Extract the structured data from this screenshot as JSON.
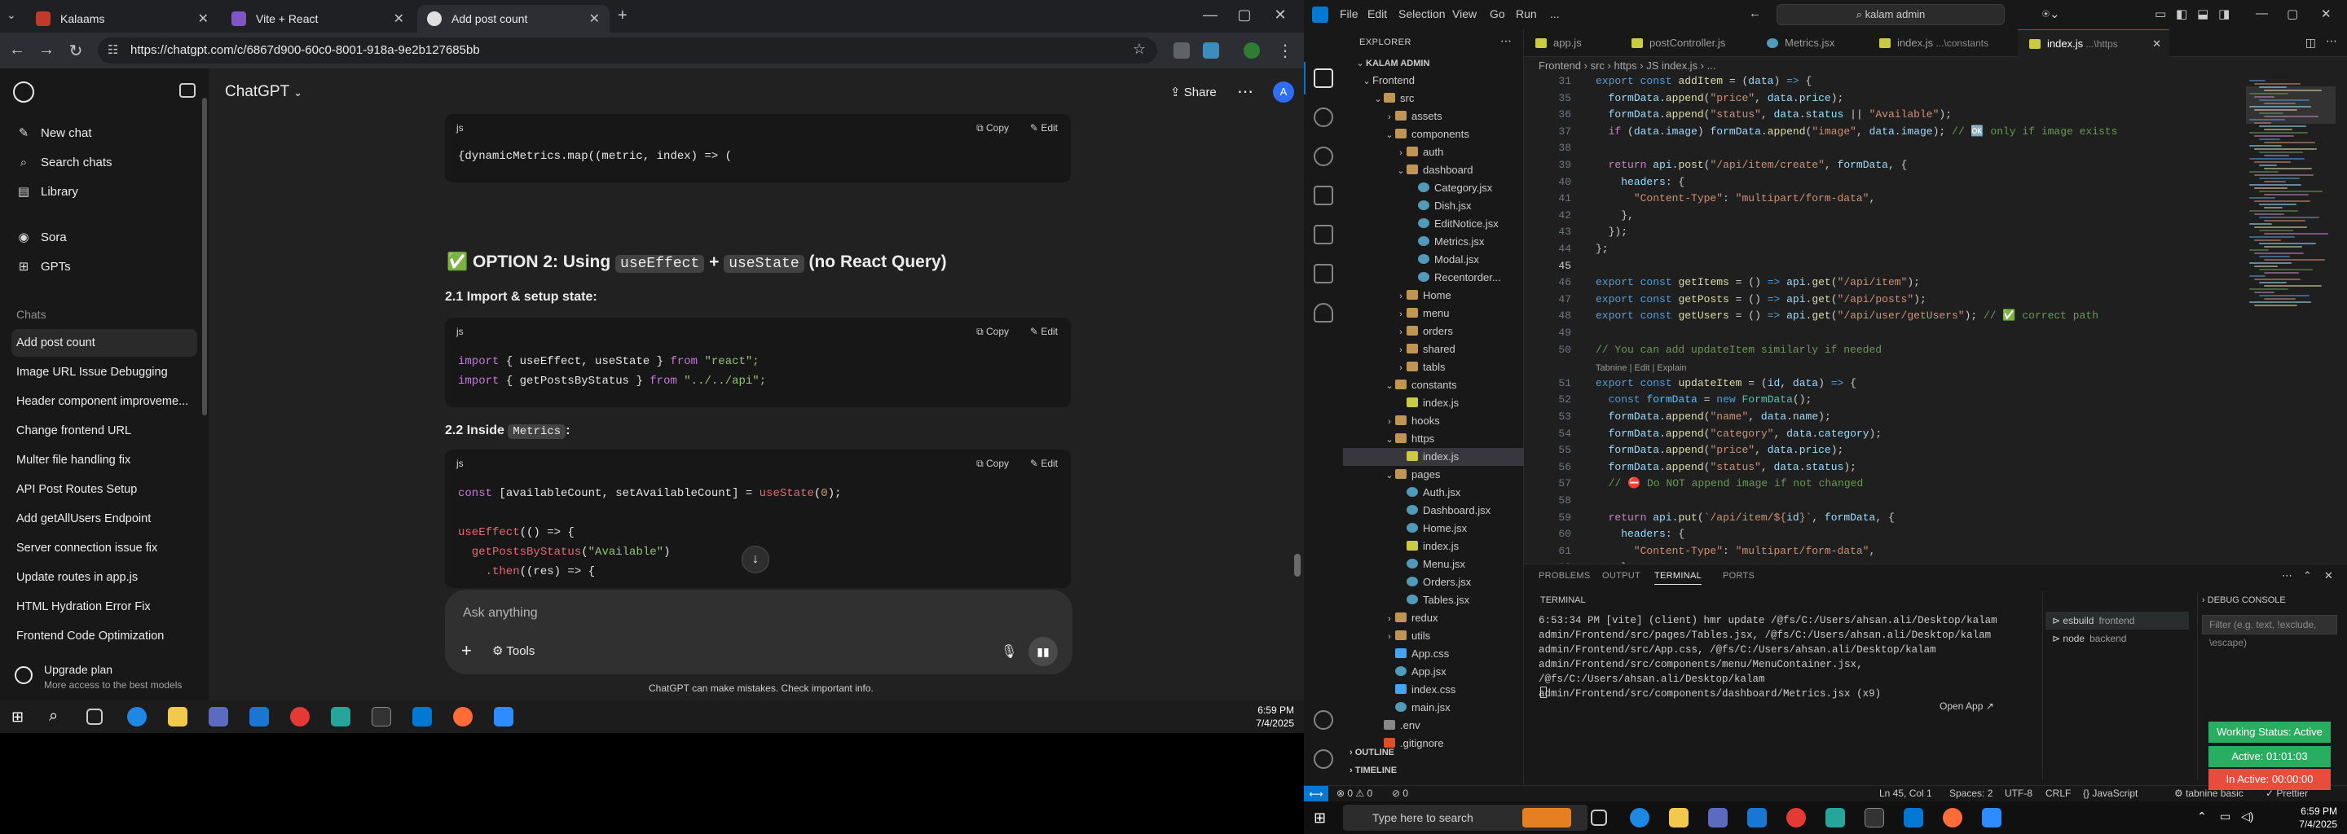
{
  "browser": {
    "tabs": [
      {
        "title": "Kalaams",
        "color": "#c0392b"
      },
      {
        "title": "Vite + React",
        "color": "#7e57c2"
      },
      {
        "title": "Add post count",
        "color": "#e0e0e0"
      }
    ],
    "new_tab": "+",
    "url": "https://chatgpt.com/c/6867d900-60c0-8001-918a-9e2b127685bb",
    "window_controls": {
      "minimize": "—",
      "maximize": "▢",
      "close": "✕"
    }
  },
  "chatgpt": {
    "sidebar": {
      "top_items": [
        {
          "label": "New chat",
          "icon": "edit-icon"
        },
        {
          "label": "Search chats",
          "icon": "search-icon"
        },
        {
          "label": "Library",
          "icon": "library-icon"
        },
        {
          "label": "Sora",
          "icon": "sora-icon"
        },
        {
          "label": "GPTs",
          "icon": "gpts-icon"
        }
      ],
      "chats_header": "Chats",
      "chats": [
        "Add post count",
        "Image URL Issue Debugging",
        "Header component improveme...",
        "Change frontend URL",
        "Multer file handling fix",
        "API Post Routes Setup",
        "Add getAllUsers Endpoint",
        "Server connection issue fix",
        "Update routes in app.js",
        "HTML Hydration Error Fix",
        "Frontend Code Optimization"
      ],
      "upgrade_title": "Upgrade plan",
      "upgrade_sub": "More access to the best models"
    },
    "header": {
      "model": "ChatGPT",
      "share": "Share",
      "avatar": "A"
    },
    "blocks": {
      "block1": {
        "lang": "js",
        "copy": "Copy",
        "edit": "Edit",
        "line": "{dynamicMetrics.map((metric, index) => ("
      },
      "option2_pre": "OPTION 2: Using",
      "option2_code1": "useEffect",
      "option2_plus": "+",
      "option2_code2": "useState",
      "option2_post": "(no React Query)",
      "h21": "2.1 Import & setup state:",
      "block2": {
        "lang": "js",
        "copy": "Copy",
        "edit": "Edit",
        "l1a": "import",
        "l1b": " { useEffect, useState } ",
        "l1c": "from",
        "l1d": "\"react\";",
        "l2a": "import",
        "l2b": " { getPostsByStatus } ",
        "l2c": "from",
        "l2d": "\"../../api\";"
      },
      "h22_pre": "2.2 Inside",
      "h22_code": "Metrics",
      "h22_post": ":",
      "block3": {
        "lang": "js",
        "copy": "Copy",
        "edit": "Edit",
        "l1a": "const",
        "l1b": " [availableCount, setAvailableCount] = ",
        "l1c": "useState",
        "l1d": "(",
        "l1e": "0",
        "l1f": ");",
        "l2a": "useEffect",
        "l2b": "(() => {",
        "l3a": "  getPostsByStatus",
        "l3b": "(",
        "l3c": "\"Available\"",
        "l3d": ")",
        "l4a": "    .then",
        "l4b": "((res) => {"
      }
    },
    "composer": {
      "placeholder": "Ask anything",
      "tools": "Tools"
    },
    "disclaimer": "ChatGPT can make mistakes. Check important info."
  },
  "taskbar_left": {
    "time": "6:59 PM",
    "date": "7/4/2025"
  },
  "vscode": {
    "menus": [
      "File",
      "Edit",
      "Selection",
      "View",
      "Go",
      "Run",
      "..."
    ],
    "search": "kalam admin",
    "explorer_header": "EXPLORER",
    "tree": [
      {
        "label": "KALAM ADMIN",
        "depth": 0,
        "chev": "⌄",
        "type": "root"
      },
      {
        "label": "Frontend",
        "depth": 1,
        "chev": "⌄",
        "type": "none"
      },
      {
        "label": "src",
        "depth": 2,
        "chev": "⌄",
        "type": "folder"
      },
      {
        "label": "assets",
        "depth": 3,
        "chev": "›",
        "type": "folder"
      },
      {
        "label": "components",
        "depth": 3,
        "chev": "⌄",
        "type": "folder"
      },
      {
        "label": "auth",
        "depth": 4,
        "chev": "›",
        "type": "folder"
      },
      {
        "label": "dashboard",
        "depth": 4,
        "chev": "⌄",
        "type": "folder"
      },
      {
        "label": "Category.jsx",
        "depth": 5,
        "chev": "",
        "type": "jsx"
      },
      {
        "label": "Dish.jsx",
        "depth": 5,
        "chev": "",
        "type": "jsx"
      },
      {
        "label": "EditNotice.jsx",
        "depth": 5,
        "chev": "",
        "type": "jsx"
      },
      {
        "label": "Metrics.jsx",
        "depth": 5,
        "chev": "",
        "type": "jsx"
      },
      {
        "label": "Modal.jsx",
        "depth": 5,
        "chev": "",
        "type": "jsx"
      },
      {
        "label": "Recentorder...",
        "depth": 5,
        "chev": "",
        "type": "jsx"
      },
      {
        "label": "Home",
        "depth": 4,
        "chev": "›",
        "type": "folder"
      },
      {
        "label": "menu",
        "depth": 4,
        "chev": "›",
        "type": "folder"
      },
      {
        "label": "orders",
        "depth": 4,
        "chev": "›",
        "type": "folder"
      },
      {
        "label": "shared",
        "depth": 4,
        "chev": "›",
        "type": "folder"
      },
      {
        "label": "tabls",
        "depth": 4,
        "chev": "›",
        "type": "folder"
      },
      {
        "label": "constants",
        "depth": 3,
        "chev": "⌄",
        "type": "folder"
      },
      {
        "label": "index.js",
        "depth": 4,
        "chev": "",
        "type": "js"
      },
      {
        "label": "hooks",
        "depth": 3,
        "chev": "›",
        "type": "folder"
      },
      {
        "label": "https",
        "depth": 3,
        "chev": "⌄",
        "type": "folder"
      },
      {
        "label": "index.js",
        "depth": 4,
        "chev": "",
        "type": "js",
        "selected": true
      },
      {
        "label": "pages",
        "depth": 3,
        "chev": "⌄",
        "type": "folder"
      },
      {
        "label": "Auth.jsx",
        "depth": 4,
        "chev": "",
        "type": "jsx"
      },
      {
        "label": "Dashboard.jsx",
        "depth": 4,
        "chev": "",
        "type": "jsx"
      },
      {
        "label": "Home.jsx",
        "depth": 4,
        "chev": "",
        "type": "jsx"
      },
      {
        "label": "index.js",
        "depth": 4,
        "chev": "",
        "type": "js"
      },
      {
        "label": "Menu.jsx",
        "depth": 4,
        "chev": "",
        "type": "jsx"
      },
      {
        "label": "Orders.jsx",
        "depth": 4,
        "chev": "",
        "type": "jsx"
      },
      {
        "label": "Tables.jsx",
        "depth": 4,
        "chev": "",
        "type": "jsx"
      },
      {
        "label": "redux",
        "depth": 3,
        "chev": "›",
        "type": "folder"
      },
      {
        "label": "utils",
        "depth": 3,
        "chev": "›",
        "type": "folder"
      },
      {
        "label": "App.css",
        "depth": 3,
        "chev": "",
        "type": "css"
      },
      {
        "label": "App.jsx",
        "depth": 3,
        "chev": "",
        "type": "jsx"
      },
      {
        "label": "index.css",
        "depth": 3,
        "chev": "",
        "type": "css"
      },
      {
        "label": "main.jsx",
        "depth": 3,
        "chev": "",
        "type": "jsx"
      },
      {
        "label": ".env",
        "depth": 2,
        "chev": "",
        "type": "env"
      },
      {
        "label": ".gitignore",
        "depth": 2,
        "chev": "",
        "type": "git"
      }
    ],
    "outline": "OUTLINE",
    "timeline": "TIMELINE",
    "tabs": [
      {
        "label": "app.js",
        "dim": "",
        "color": "#cbcb41"
      },
      {
        "label": "postController.js",
        "dim": "",
        "color": "#cbcb41"
      },
      {
        "label": "Metrics.jsx",
        "dim": "",
        "color": "#519aba"
      },
      {
        "label": "index.js",
        "dim": " ...\\constants",
        "color": "#cbcb41"
      },
      {
        "label": "index.js",
        "dim": " ...\\https",
        "color": "#cbcb41",
        "active": true
      }
    ],
    "breadcrumb": "Frontend  ›  src  ›  https  ›  JS index.js  ›  ...",
    "code": [
      {
        "n": "31",
        "html": "<span class='kw'>export</span> <span class='kw'>const</span> <span class='fn'>addItem</span> = (<span class='va'>data</span>) <span class='kw'>=&gt;</span> {"
      },
      {
        "n": "35",
        "html": "  <span class='va'>formData</span>.<span class='fn'>append</span>(<span class='str'>\"price\"</span>, <span class='va'>data</span>.<span class='va'>price</span>);"
      },
      {
        "n": "36",
        "html": "  <span class='va'>formData</span>.<span class='fn'>append</span>(<span class='str'>\"status\"</span>, <span class='va'>data</span>.<span class='va'>status</span> || <span class='str'>\"Available\"</span>);"
      },
      {
        "n": "37",
        "html": "  <span class='kw2'>if</span> (<span class='va'>data</span>.<span class='va'>image</span>) <span class='va'>formData</span>.<span class='fn'>append</span>(<span class='str'>\"image\"</span>, <span class='va'>data</span>.<span class='va'>image</span>); <span class='cm'>// 🆗 only if image exists</span>"
      },
      {
        "n": "38",
        "html": ""
      },
      {
        "n": "39",
        "html": "  <span class='kw2'>return</span> <span class='va'>api</span>.<span class='fn'>post</span>(<span class='str'>\"/api/item/create\"</span>, <span class='va'>formData</span>, {"
      },
      {
        "n": "40",
        "html": "    <span class='va'>headers</span>: {"
      },
      {
        "n": "41",
        "html": "      <span class='str'>\"Content-Type\"</span>: <span class='str'>\"multipart/form-data\"</span>,"
      },
      {
        "n": "42",
        "html": "    },"
      },
      {
        "n": "43",
        "html": "  });"
      },
      {
        "n": "44",
        "html": "};"
      },
      {
        "n": "45",
        "html": "",
        "cur": true
      },
      {
        "n": "46",
        "html": "<span class='kw'>export</span> <span class='kw'>const</span> <span class='fn'>getItems</span> = () <span class='kw'>=&gt;</span> <span class='va'>api</span>.<span class='fn'>get</span>(<span class='str'>\"/api/item\"</span>);"
      },
      {
        "n": "47",
        "html": "<span class='kw'>export</span> <span class='kw'>const</span> <span class='fn'>getPosts</span> = () <span class='kw'>=&gt;</span> <span class='va'>api</span>.<span class='fn'>get</span>(<span class='str'>\"/api/posts\"</span>);"
      },
      {
        "n": "48",
        "html": "<span class='kw'>export</span> <span class='kw'>const</span> <span class='fn'>getUsers</span> = () <span class='kw'>=&gt;</span> <span class='va'>api</span>.<span class='fn'>get</span>(<span class='str'>\"/api/user/getUsers\"</span>); <span class='cm'>// ✅ correct path</span>"
      },
      {
        "n": "49",
        "html": ""
      },
      {
        "n": "50",
        "html": "<span class='cm'>// You can add updateItem similarly if needed</span>"
      },
      {
        "n": "",
        "html": "",
        "lens": "Tabnine | Edit | Explain"
      },
      {
        "n": "51",
        "html": "<span class='kw'>export</span> <span class='kw'>const</span> <span class='fn'>updateItem</span> = (<span class='va'>id</span>, <span class='va'>data</span>) <span class='kw'>=&gt;</span> {"
      },
      {
        "n": "52",
        "html": "  <span class='kw'>const</span> <span class='cn'>formData</span> = <span class='kw'>new</span> <span class='tp'>FormData</span>();"
      },
      {
        "n": "53",
        "html": "  <span class='va'>formData</span>.<span class='fn'>append</span>(<span class='str'>\"name\"</span>, <span class='va'>data</span>.<span class='va'>name</span>);"
      },
      {
        "n": "54",
        "html": "  <span class='va'>formData</span>.<span class='fn'>append</span>(<span class='str'>\"category\"</span>, <span class='va'>data</span>.<span class='va'>category</span>);"
      },
      {
        "n": "55",
        "html": "  <span class='va'>formData</span>.<span class='fn'>append</span>(<span class='str'>\"price\"</span>, <span class='va'>data</span>.<span class='va'>price</span>);"
      },
      {
        "n": "56",
        "html": "  <span class='va'>formData</span>.<span class='fn'>append</span>(<span class='str'>\"status\"</span>, <span class='va'>data</span>.<span class='va'>status</span>);"
      },
      {
        "n": "57",
        "html": "  <span class='cm'>// ⛔ Do NOT append image if not changed</span>"
      },
      {
        "n": "58",
        "html": ""
      },
      {
        "n": "59",
        "html": "  <span class='kw2'>return</span> <span class='va'>api</span>.<span class='fn'>put</span>(<span class='str'>`/api/item/${</span><span class='va'>id</span><span class='str'>}`</span>, <span class='va'>formData</span>, {"
      },
      {
        "n": "60",
        "html": "    <span class='va'>headers</span>: {"
      },
      {
        "n": "61",
        "html": "      <span class='str'>\"Content-Type\"</span>: <span class='str'>\"multipart/form-data\"</span>,"
      },
      {
        "n": "62",
        "html": "    },"
      },
      {
        "n": "63",
        "html": "  });"
      },
      {
        "n": "64",
        "html": "};"
      }
    ],
    "panel_tabs": [
      "PROBLEMS",
      "OUTPUT",
      "TERMINAL",
      "PORTS"
    ],
    "terminal_header": "TERMINAL",
    "debug_header": "DEBUG CONSOLE",
    "terminal_output": "6:53:34 PM [vite] (client) hmr update /@fs/C:/Users/ahsan.ali/Desktop/kalam admin/Frontend/src/pages/Tables.jsx, /@fs/C:/Users/ahsan.ali/Desktop/kalam admin/Frontend/src/App.css, /@fs/C:/Users/ahsan.ali/Desktop/kalam admin/Frontend/src/components/menu/MenuContainer.jsx, /@fs/C:/Users/ahsan.ali/Desktop/kalam admin/Frontend/src/components/dashboard/Metrics.jsx (x9)",
    "terminals": [
      {
        "name": "esbuild",
        "sub": "frontend",
        "selected": true
      },
      {
        "name": "node",
        "sub": "backend"
      }
    ],
    "filter_placeholder": "Filter (e.g. text, !exclude, \\escape)",
    "open_app": "Open App ↗",
    "status_pills": [
      {
        "label": "Working Status: Active",
        "color": "#27ae60"
      },
      {
        "label": "Active: 01:01:03",
        "color": "#27ae60"
      },
      {
        "label": "In Active: 00:00:00",
        "color": "#e74c3c"
      }
    ],
    "status": {
      "errors": "⊗ 0  ⚠ 0",
      "ports": "⊘ 0",
      "position": "Ln 45, Col 1",
      "spaces": "Spaces: 2",
      "encoding": "UTF-8",
      "eol": "CRLF",
      "lang": "{} JavaScript",
      "tabnine": "⚙ tabnine basic",
      "prettier": "✓ Prettier"
    }
  },
  "taskbar_right": {
    "search": "Type here to search",
    "time": "6:59 PM",
    "date": "7/4/2025"
  },
  "colors": {
    "vscode_accent": "#0078d4",
    "chatgpt_bg": "#212121"
  }
}
